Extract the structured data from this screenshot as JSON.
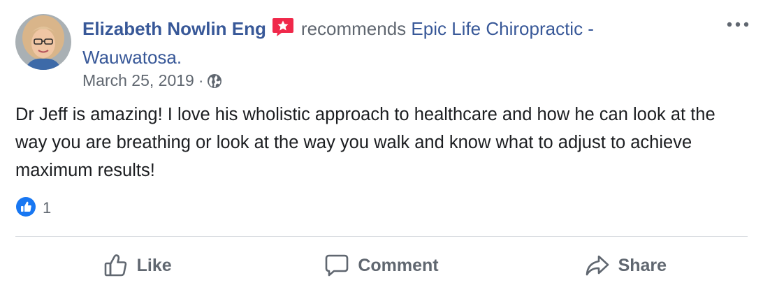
{
  "post": {
    "author": "Elizabeth Nowlin Eng",
    "verb": "recommends",
    "page_name": "Epic Life Chiropractic - Wauwatosa.",
    "date": "March 25, 2019",
    "separator": "·",
    "privacy_icon": "globe-icon",
    "badge_icon": "recommend-star-icon",
    "more_icon": "more-options-icon",
    "review_text": "Dr Jeff is amazing! I love his wholistic approach to healthcare and how he can look at the way you are breathing or look at the way you walk and know what to adjust to achieve maximum results!"
  },
  "reactions": {
    "icon": "like-reaction-icon",
    "count": "1"
  },
  "actions": [
    {
      "label": "Like",
      "icon": "thumbs-up-icon"
    },
    {
      "label": "Comment",
      "icon": "comment-icon"
    },
    {
      "label": "Share",
      "icon": "share-arrow-icon"
    }
  ],
  "colors": {
    "link": "#385898",
    "secondary_text": "#606770",
    "badge": "#f0284a",
    "like_blue": "#1877f2",
    "divider": "#dadde1"
  }
}
